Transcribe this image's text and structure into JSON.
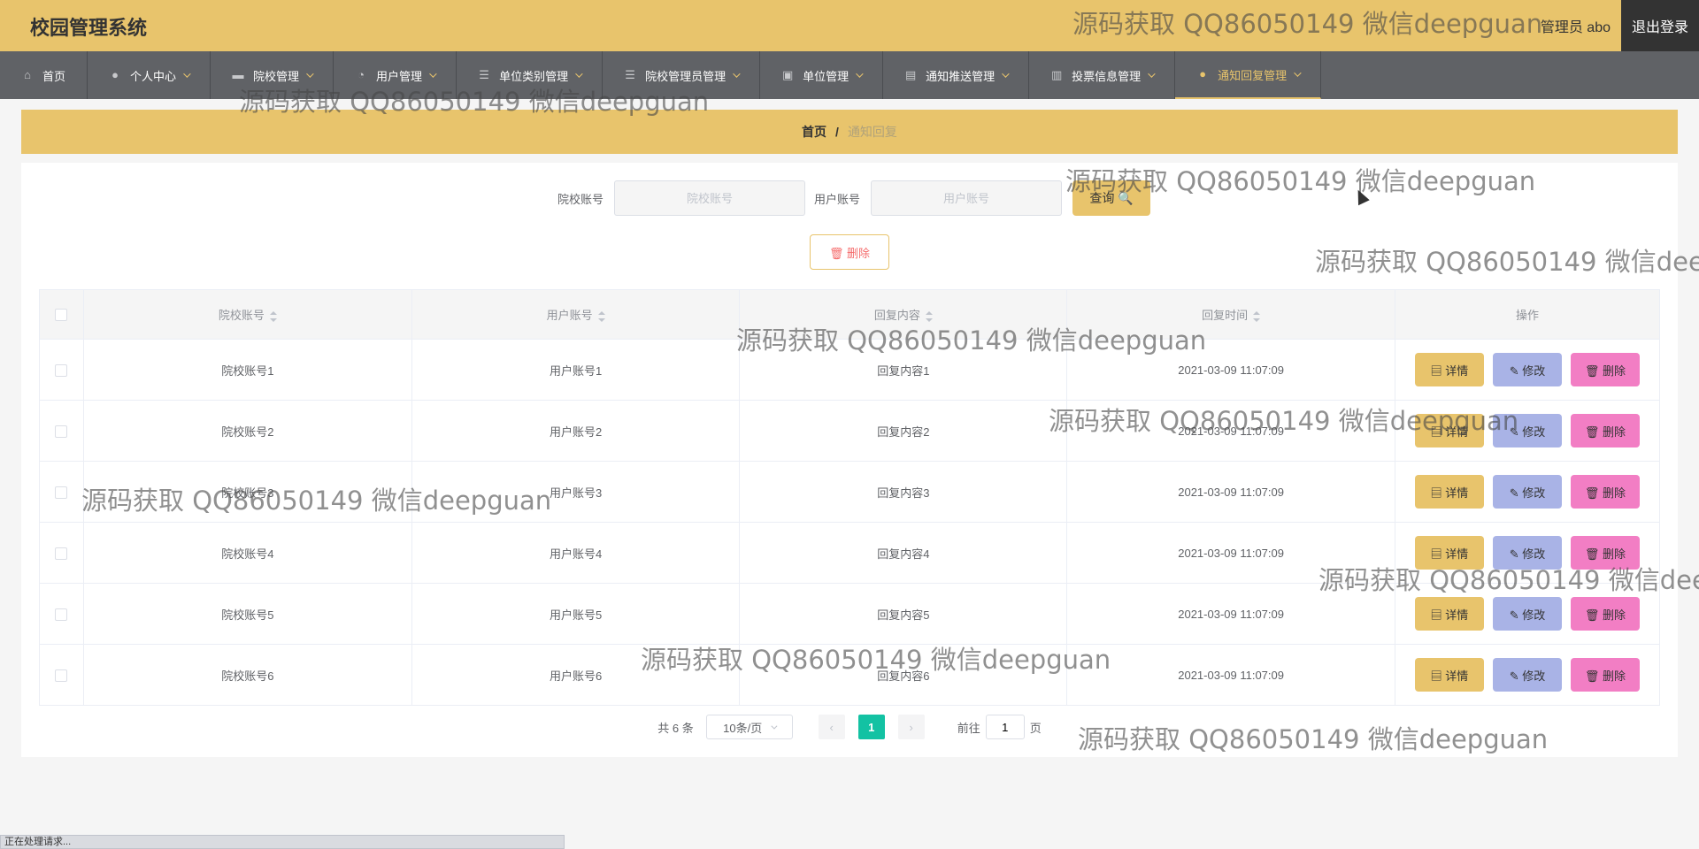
{
  "header": {
    "title": "校园管理系统",
    "user_label": "管理员 abo",
    "logout_label": "退出登录"
  },
  "nav": {
    "items": [
      {
        "label": "首页",
        "icon": "home-icon"
      },
      {
        "label": "个人中心",
        "icon": "user-icon"
      },
      {
        "label": "院校管理",
        "icon": "ticket-icon"
      },
      {
        "label": "用户管理",
        "icon": "dial-icon"
      },
      {
        "label": "单位类别管理",
        "icon": "list-icon"
      },
      {
        "label": "院校管理员管理",
        "icon": "list-icon"
      },
      {
        "label": "单位管理",
        "icon": "chart-icon"
      },
      {
        "label": "通知推送管理",
        "icon": "briefcase-icon"
      },
      {
        "label": "投票信息管理",
        "icon": "bar-icon"
      },
      {
        "label": "通知回复管理",
        "icon": "user-icon",
        "active": true
      }
    ]
  },
  "breadcrumb": {
    "home": "首页",
    "separator": "/",
    "current": "通知回复"
  },
  "search": {
    "school_label": "院校账号",
    "school_placeholder": "院校账号",
    "user_label": "用户账号",
    "user_placeholder": "用户账号",
    "query_label": "查询 🔍"
  },
  "batch_delete_label": "🗑 删除",
  "table": {
    "columns": [
      "院校账号",
      "用户账号",
      "回复内容",
      "回复时间",
      "操作"
    ],
    "rows": [
      {
        "school": "院校账号1",
        "user": "用户账号1",
        "content": "回复内容1",
        "time": "2021-03-09 11:07:09"
      },
      {
        "school": "院校账号2",
        "user": "用户账号2",
        "content": "回复内容2",
        "time": "2021-03-09 11:07:09"
      },
      {
        "school": "院校账号3",
        "user": "用户账号3",
        "content": "回复内容3",
        "time": "2021-03-09 11:07:09"
      },
      {
        "school": "院校账号4",
        "user": "用户账号4",
        "content": "回复内容4",
        "time": "2021-03-09 11:07:09"
      },
      {
        "school": "院校账号5",
        "user": "用户账号5",
        "content": "回复内容5",
        "time": "2021-03-09 11:07:09"
      },
      {
        "school": "院校账号6",
        "user": "用户账号6",
        "content": "回复内容6",
        "time": "2021-03-09 11:07:09"
      }
    ],
    "actions": {
      "detail": "详情",
      "edit": "修改",
      "delete": "删除"
    }
  },
  "pagination": {
    "total": "共 6 条",
    "page_size": "10条/页",
    "current_page": "1",
    "goto_prefix": "前往",
    "goto_value": "1",
    "goto_suffix": "页"
  },
  "status_text": "正在处理请求...",
  "watermark": "源码获取 QQ86050149 微信deepguan",
  "colors": {
    "accent": "#e8c46c",
    "nav_bg": "#606266",
    "edit_button": "#a9b3e6",
    "delete_button": "#f27ec4",
    "page_active": "#13c2a3"
  }
}
